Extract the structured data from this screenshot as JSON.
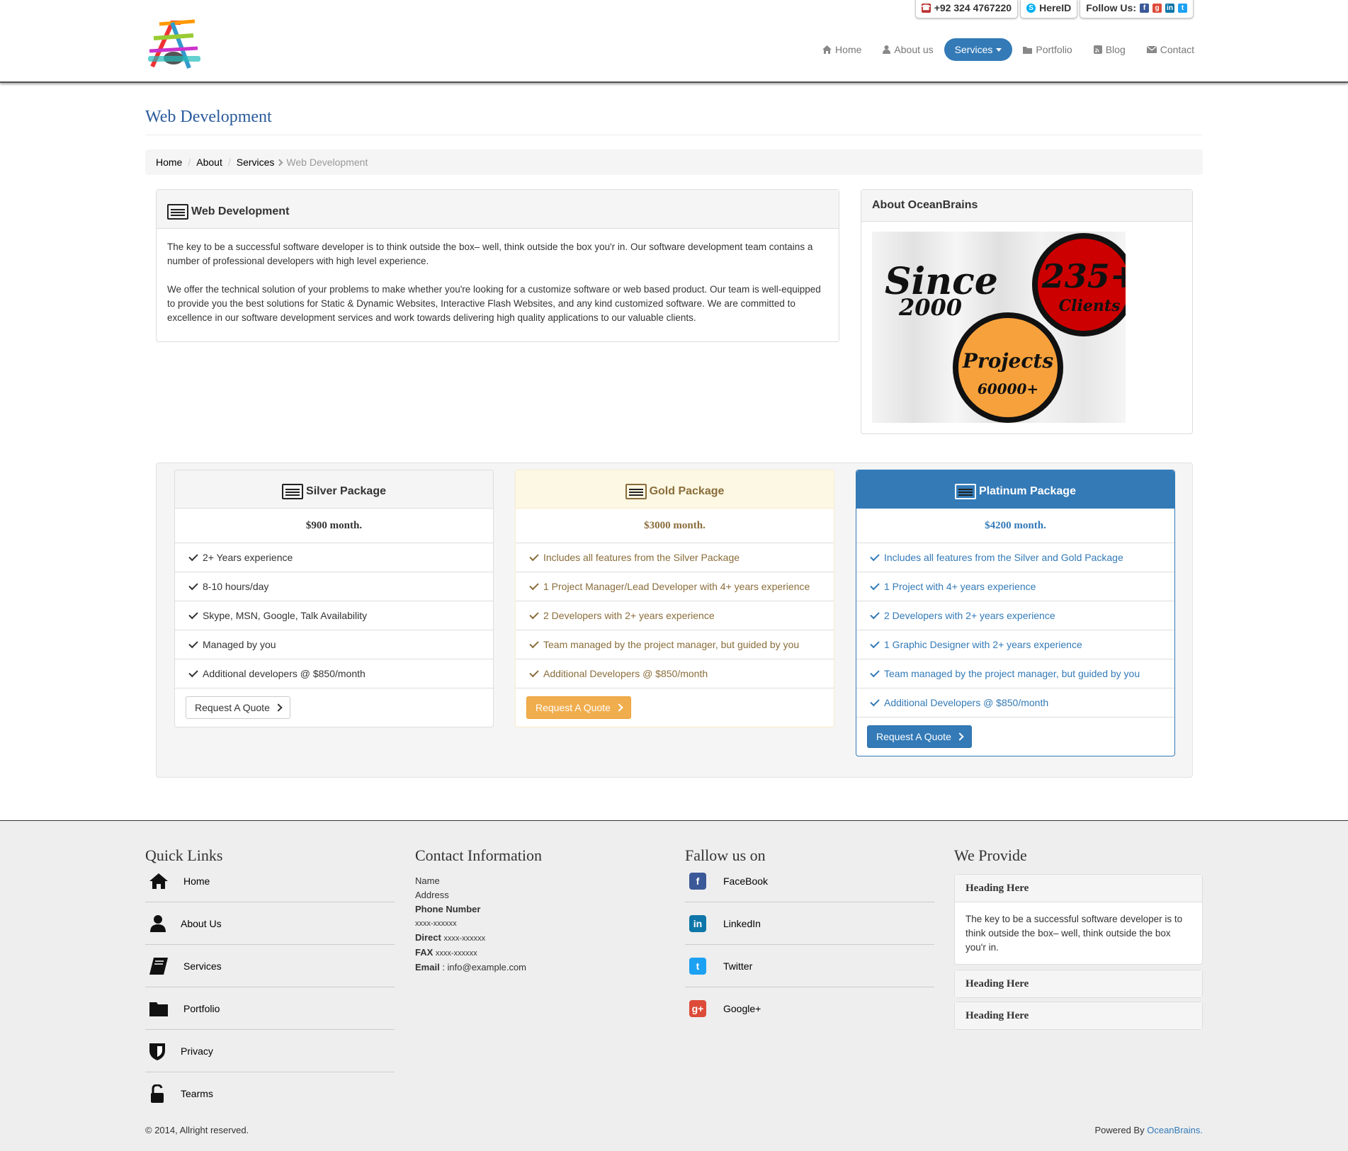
{
  "topbar": {
    "phone": "+92 324 4767220",
    "skype": "HereID",
    "follow_label": "Follow Us:"
  },
  "nav": [
    {
      "label": "Home",
      "icon": "home-icon"
    },
    {
      "label": "About us",
      "icon": "user-icon"
    },
    {
      "label": "Services",
      "icon": "caret-down-icon",
      "active": true
    },
    {
      "label": "Portfolio",
      "icon": "folder-icon"
    },
    {
      "label": "Blog",
      "icon": "rss-icon"
    },
    {
      "label": "Contact",
      "icon": "envelope-icon"
    }
  ],
  "page_title": "Web Development",
  "breadcrumb": {
    "home": "Home",
    "about": "About",
    "services": "Services",
    "current": "Web Development"
  },
  "main_panel": {
    "title": "Web Development",
    "p1": "The key to be a successful software developer is to think outside the box– well, think outside the box you'r in. Our software development team contains a number of professional developers with high level experience.",
    "p2": "We offer the technical solution of your problems to make whether you're looking for a customize software or web based product. Our team is well-equipped to provide you the best solutions for Static & Dynamic Websites, Interactive Flash Websites, and any kind customized software. We are committed to excellence in our software development services and work towards delivering high quality applications to our valuable clients."
  },
  "about_panel": {
    "title": "About OceanBrains",
    "since": "Since",
    "year": "2000",
    "clients_num": "235+",
    "clients": "Clients",
    "projects": "Projects",
    "projects_num": "60000+"
  },
  "packages": [
    {
      "name": "Silver Package",
      "price": "$900 month.",
      "features": [
        "2+ Years experience",
        "8-10 hours/day",
        "Skype, MSN, Google, Talk Availability",
        "Managed by you",
        "Additional developers @ $850/month"
      ],
      "button": "Request A Quote"
    },
    {
      "name": "Gold Package",
      "price": "$3000 month.",
      "features": [
        "Includes all features from the Silver Package",
        "1 Project Manager/Lead Developer with 4+ years experience",
        "2 Developers with 2+ years experience",
        "Team managed by the project manager, but guided by you",
        "Additional Developers @ $850/month"
      ],
      "button": "Request A Quote"
    },
    {
      "name": "Platinum Package",
      "price": "$4200 month.",
      "features": [
        "Includes all features from the Silver and Gold Package",
        "1 Project with 4+ years experience",
        "2 Developers with 2+ years experience",
        "1 Graphic Designer with 2+ years experience",
        "Team managed by the project manager, but guided by you",
        "Additional Developers @ $850/month"
      ],
      "button": "Request A Quote"
    }
  ],
  "footer": {
    "quick_links_title": "Quick Links",
    "quick_links": [
      "Home",
      "About Us",
      "Services",
      "Portfolio",
      "Privacy",
      "Tearms"
    ],
    "contact_title": "Contact Information",
    "contact": {
      "name": "Name",
      "address": "Address",
      "phone_label": "Phone Number",
      "phone": "xxxx-xxxxxx",
      "direct_label": "Direct",
      "direct": "xxxx-xxxxxx",
      "fax_label": "FAX",
      "fax": "xxxx-xxxxxx",
      "email_label": "Email",
      "email": ": info@example.com"
    },
    "follow_title": "Fallow us on",
    "follow": [
      "FaceBook",
      "LinkedIn",
      "Twitter",
      "Google+"
    ],
    "provide_title": "We Provide",
    "provide": [
      {
        "heading": "Heading Here",
        "body": "The key to be a successful software developer is to think outside the box– well, think outside the box you'r in."
      },
      {
        "heading": "Heading Here"
      },
      {
        "heading": "Heading Here"
      }
    ],
    "copyright": "© 2014, Allright reserved.",
    "powered_label": "Powered By",
    "powered_link": "OceanBrains."
  },
  "colors": {
    "primary": "#337ab7",
    "gold_head": "#fcf8e3",
    "gold_text": "#8a6d3b",
    "gold_btn": "#f0ad4e",
    "title_blue": "#2a5a9c"
  }
}
